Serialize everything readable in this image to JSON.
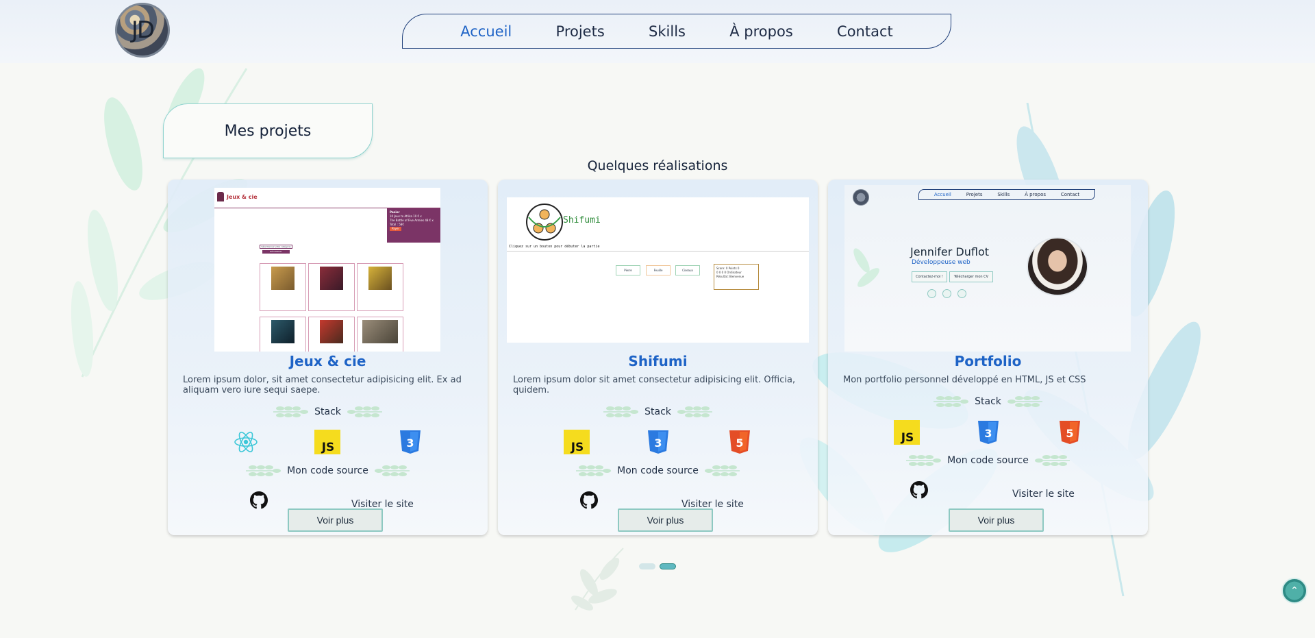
{
  "header": {
    "logo_text": "JD",
    "nav": [
      {
        "label": "Accueil",
        "active": true
      },
      {
        "label": "Projets",
        "active": false
      },
      {
        "label": "Skills",
        "active": false
      },
      {
        "label": "À propos",
        "active": false
      },
      {
        "label": "Contact",
        "active": false
      }
    ]
  },
  "section": {
    "title": "Mes projets",
    "subtitle": "Quelques réalisations"
  },
  "projects": [
    {
      "title": "Jeux & cie",
      "description": "Lorem ipsum dolor, sit amet consectetur adipisicing elit. Ex ad aliquam vero iure sequi saepe.",
      "stack_label": "Stack",
      "stack": [
        "react-icon",
        "js-icon",
        "css3-icon"
      ],
      "source_label": "Mon code source",
      "visit_label": "Visiter le site",
      "button_label": "Voir plus",
      "thumb_text": {
        "brand": "Jeux & cie",
        "panel_title": "Panier",
        "panel_line1": "10 Jeux to Afrika 10 € x",
        "panel_line2": "The Battle of Five Armies 48 € x",
        "panel_total": "Total : 58€",
        "panel_button": "Payer",
        "filter_label": "Sélectionnez votre catégorie",
        "filter_button": "Réinitialiser"
      }
    },
    {
      "title": "Shifumi",
      "description": "Lorem ipsum dolor sit amet consectetur adipisicing elit. Officia, quidem.",
      "stack_label": "Stack",
      "stack": [
        "js-icon",
        "css3-icon",
        "html5-icon"
      ],
      "source_label": "Mon code source",
      "visit_label": "Visiter le site",
      "button_label": "Voir plus",
      "thumb_text": {
        "brand": "Shifumi",
        "instruction": "Cliquez sur un bouton pour débuter la partie",
        "btn1": "Pierre",
        "btn2": "Feuille",
        "btn3": "Ciseaux",
        "score_line1": "Score: 0 Points 0",
        "score_line2": "0 0 0 0 Ordinateur",
        "score_line3": "Résultat: Bienvenue"
      }
    },
    {
      "title": "Portfolio",
      "description": "Mon portfolio personnel développé en HTML, JS et CSS",
      "stack_label": "Stack",
      "stack": [
        "js-icon",
        "css3-icon",
        "html5-icon"
      ],
      "source_label": "Mon code source",
      "visit_label": "Visiter le site",
      "button_label": "Voir plus",
      "thumb_text": {
        "nav": [
          "Accueil",
          "Projets",
          "Skills",
          "À propos",
          "Contact"
        ],
        "name": "Jennifer Duflot",
        "role": "Développeuse web",
        "btn1": "Contactez-moi !",
        "btn2": "Télécharger mon CV"
      }
    }
  ],
  "carousel": {
    "dots": [
      {
        "active": false
      },
      {
        "active": true
      }
    ]
  },
  "scroll_top": {
    "icon": "chevron-up-icon"
  },
  "colors": {
    "accent_blue": "#1e63c6",
    "teal": "#8fd3cf",
    "leaf_green": "#cfeedd",
    "leaf_teal": "#b6e4ea"
  }
}
